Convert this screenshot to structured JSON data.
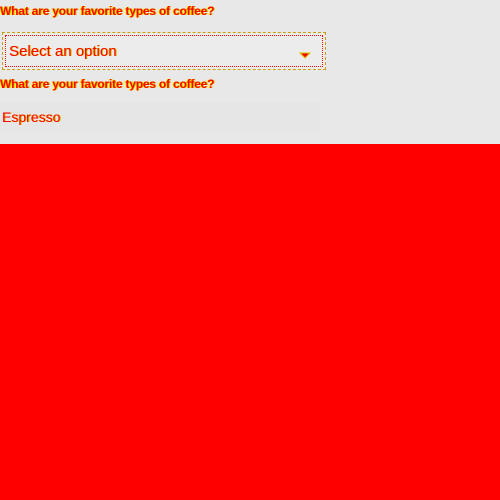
{
  "form": {
    "question_1": "What are your favorite types of coffee?",
    "select": {
      "selected_label": "Select an option",
      "caret_icon": "chevron-down-icon"
    },
    "question_2": "What are your favorite types of coffee?",
    "text_input": {
      "value": "",
      "placeholder": "Espresso"
    }
  },
  "colors": {
    "page_background": "#ff0000",
    "panel_background": "#e8e8e8",
    "text": "#ff0000",
    "text_shadow": "#d4c600",
    "border": "#c9a000"
  }
}
